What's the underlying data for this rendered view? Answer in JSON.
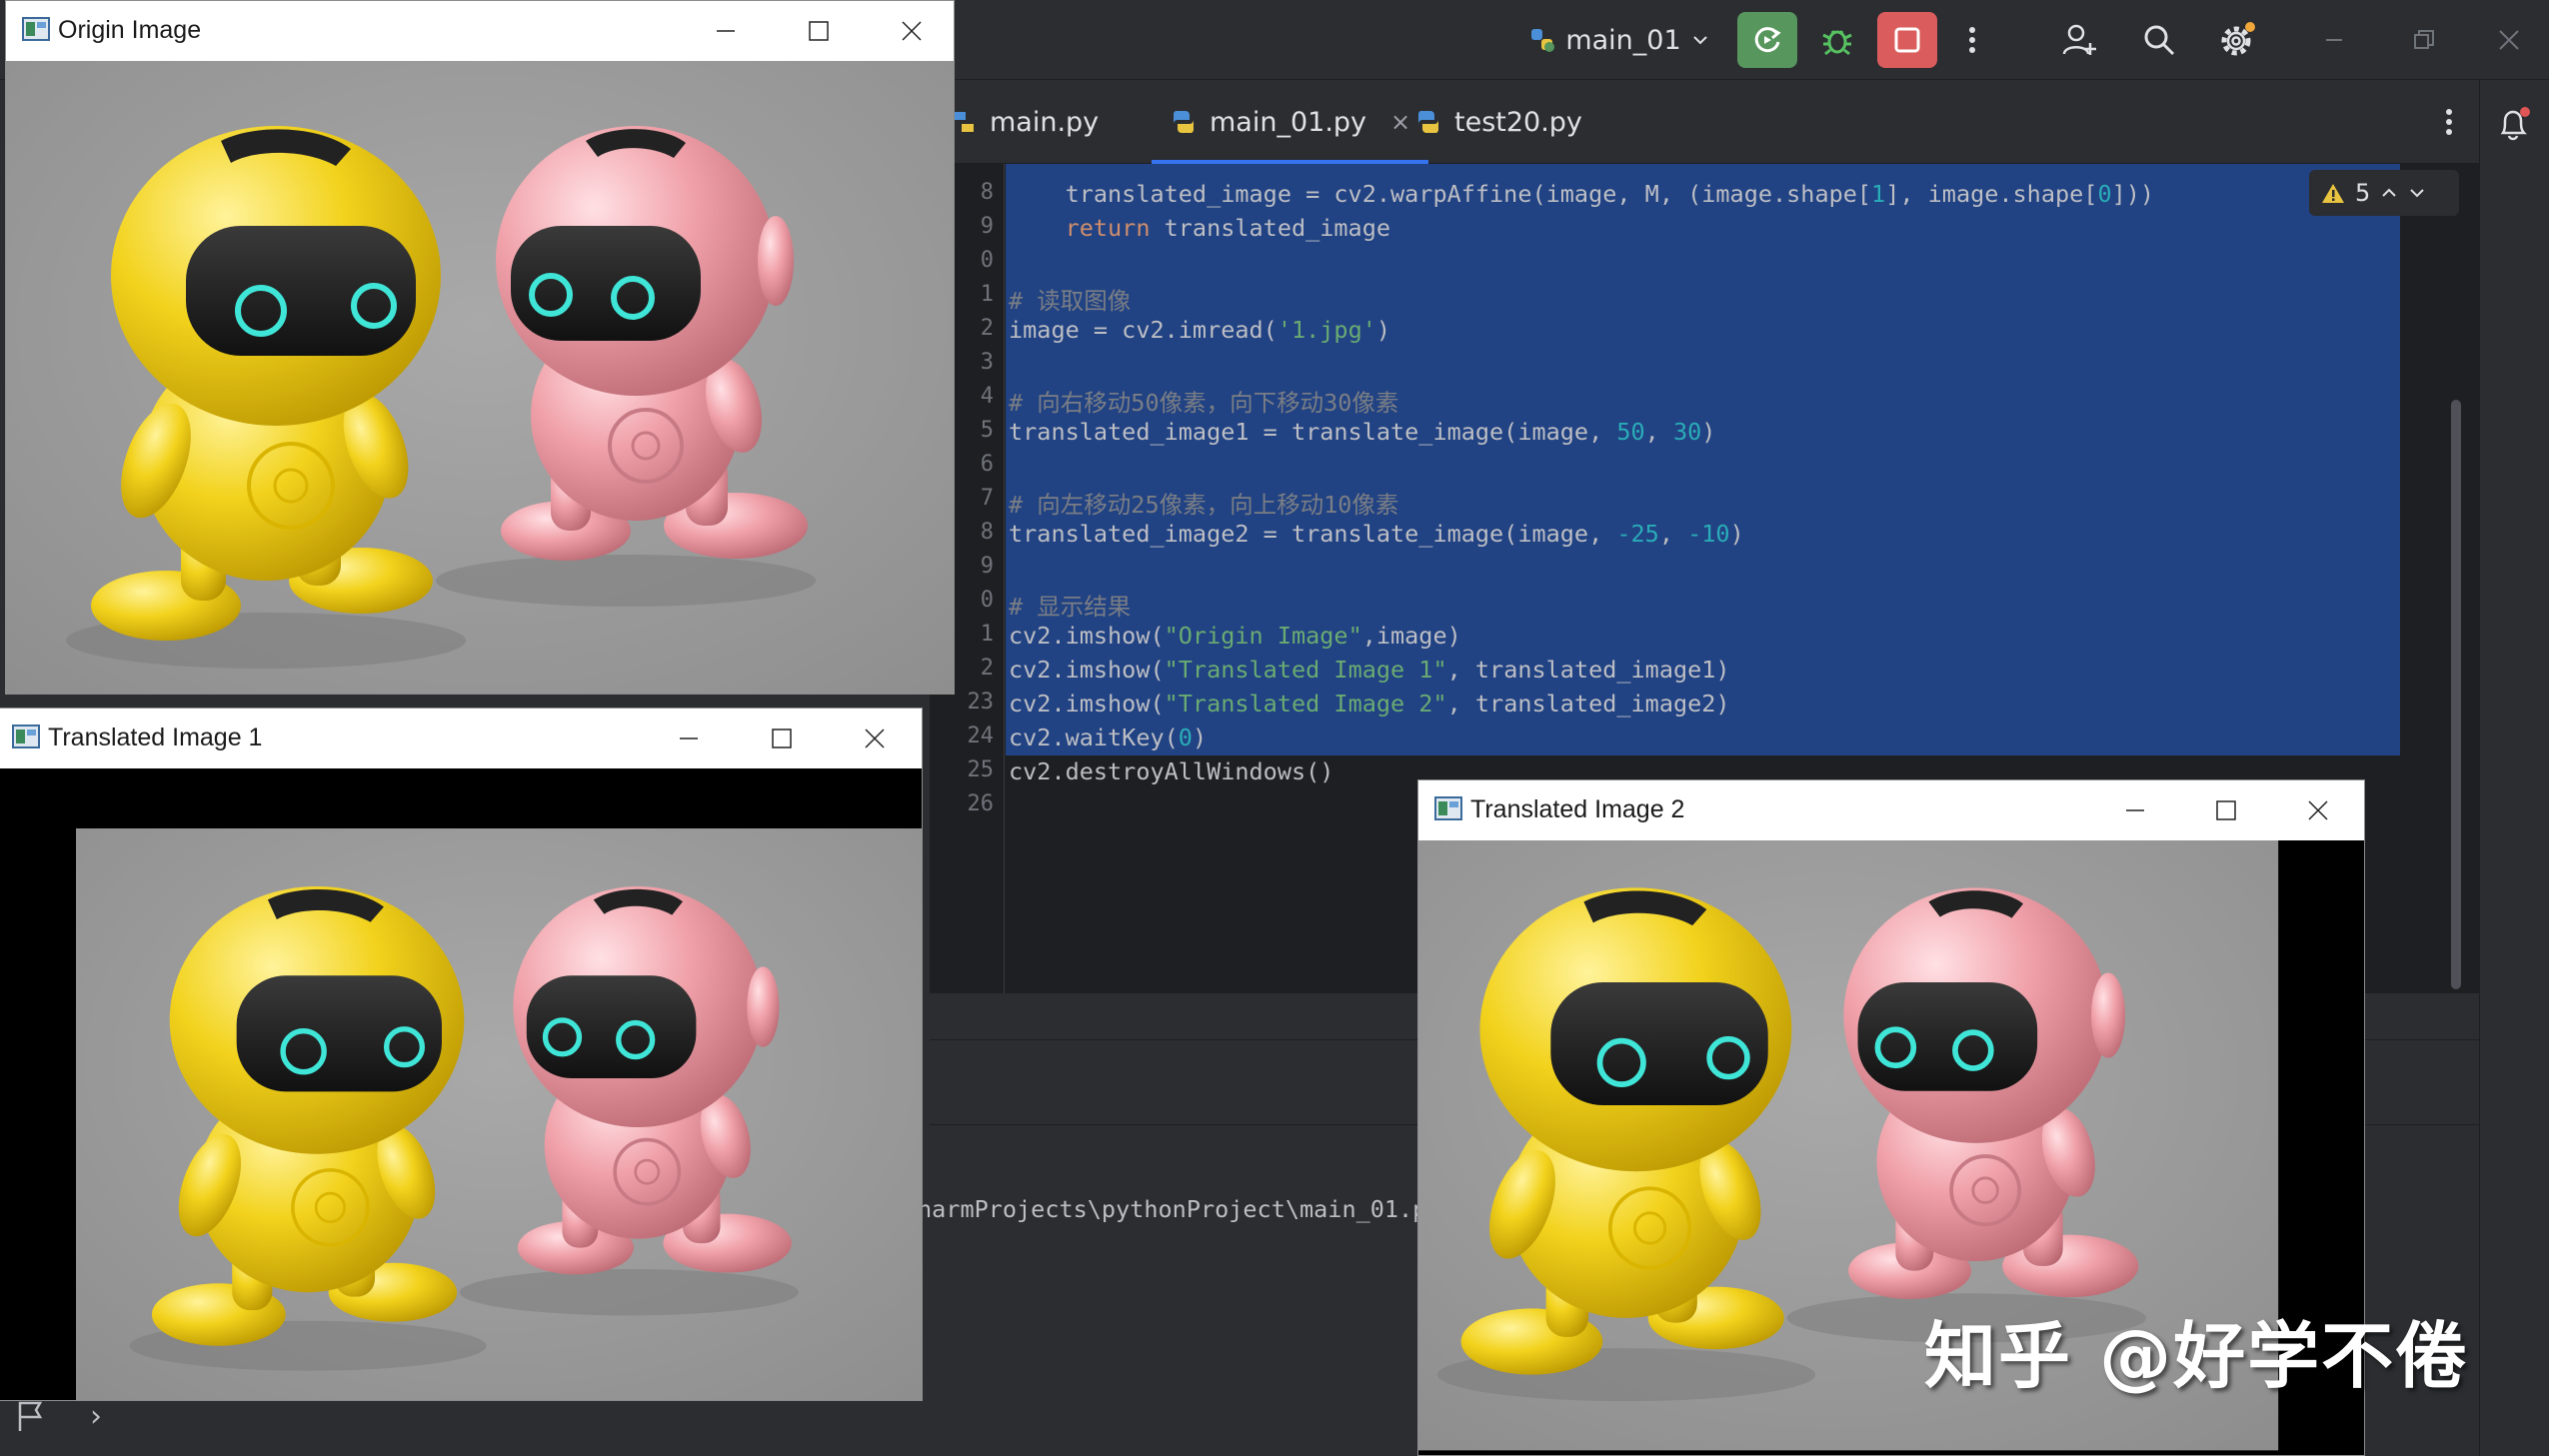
{
  "ide": {
    "run_config": "main_01",
    "tabs": [
      {
        "label": "main.py"
      },
      {
        "label": "main_01.py",
        "close": "×"
      },
      {
        "label": "test20.py"
      }
    ],
    "warnings_count": "5",
    "console_path": "harmProjects\\pythonProject\\main_01.p",
    "line_numbers": [
      "8",
      "9",
      "0",
      "1",
      "2",
      "3",
      "4",
      "5",
      "6",
      "7",
      "8",
      "9",
      "0",
      "1",
      "2",
      "23",
      "24",
      "25",
      "26"
    ],
    "code_lines": [
      [
        {
          "t": "    translated_image = cv2.warpAffine(image, M, (image.shape["
        },
        {
          "t": "1",
          "c": "num"
        },
        {
          "t": "], image.shape["
        },
        {
          "t": "0",
          "c": "num"
        },
        {
          "t": "]))"
        }
      ],
      [
        {
          "t": "    "
        },
        {
          "t": "return",
          "c": "kw"
        },
        {
          "t": " translated_image"
        }
      ],
      [
        {
          "t": ""
        }
      ],
      [
        {
          "t": "# 读取图像",
          "c": "cm"
        }
      ],
      [
        {
          "t": "image = cv2.imread("
        },
        {
          "t": "'1.jpg'",
          "c": "str"
        },
        {
          "t": ")"
        }
      ],
      [
        {
          "t": ""
        }
      ],
      [
        {
          "t": "# 向右移动50像素，向下移动30像素",
          "c": "cm"
        }
      ],
      [
        {
          "t": "translated_image1 = translate_image(image, "
        },
        {
          "t": "50",
          "c": "num"
        },
        {
          "t": ", "
        },
        {
          "t": "30",
          "c": "num"
        },
        {
          "t": ")"
        }
      ],
      [
        {
          "t": ""
        }
      ],
      [
        {
          "t": "# 向左移动25像素，向上移动10像素",
          "c": "cm"
        }
      ],
      [
        {
          "t": "translated_image2 = translate_image(image, "
        },
        {
          "t": "-25",
          "c": "num"
        },
        {
          "t": ", "
        },
        {
          "t": "-10",
          "c": "num"
        },
        {
          "t": ")"
        }
      ],
      [
        {
          "t": ""
        }
      ],
      [
        {
          "t": "# 显示结果",
          "c": "cm"
        }
      ],
      [
        {
          "t": "cv2.imshow("
        },
        {
          "t": "\"Origin Image\"",
          "c": "str"
        },
        {
          "t": ",image)"
        }
      ],
      [
        {
          "t": "cv2.imshow("
        },
        {
          "t": "\"Translated Image 1\"",
          "c": "str"
        },
        {
          "t": ", translated_image1)"
        }
      ],
      [
        {
          "t": "cv2.imshow("
        },
        {
          "t": "\"Translated Image 2\"",
          "c": "str"
        },
        {
          "t": ", translated_image2)"
        }
      ],
      [
        {
          "t": "cv2.waitKey("
        },
        {
          "t": "0",
          "c": "num"
        },
        {
          "t": ")"
        }
      ],
      [
        {
          "t": "cv2.destroyAllWindows()"
        }
      ],
      [
        {
          "t": ""
        }
      ]
    ]
  },
  "windows": {
    "origin": {
      "title": "Origin Image"
    },
    "t1": {
      "title": "Translated Image 1"
    },
    "t2": {
      "title": "Translated Image 2"
    }
  },
  "watermark": "知乎 @好学不倦",
  "colors": {
    "robot_yellow": "#f2d21c",
    "robot_pink": "#f0a0a8",
    "eye_glow": "#3fe6d8",
    "selection": "#214283",
    "run_green": "#57965c",
    "stop_red": "#db5c5c"
  },
  "icons": [
    "cfg-python-icon",
    "rerun-icon",
    "debug-bug-icon",
    "stop-icon",
    "more-vert-icon",
    "add-user-icon",
    "search-icon",
    "gear-icon",
    "minimize-icon",
    "restore-icon",
    "close-icon",
    "python-file-icon",
    "bell-icon",
    "warning-icon",
    "chevron-up-icon",
    "chevron-down-icon",
    "opencv-window-icon",
    "flag-icon",
    "chevron-right-icon"
  ]
}
